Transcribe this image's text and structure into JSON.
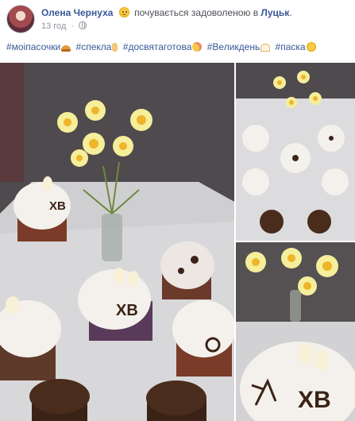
{
  "post": {
    "author": "Олена Чернуха",
    "feeling": "почувається задоволеною в",
    "location": "Луцьк",
    "location_suffix": ".",
    "timestamp": "13 год",
    "separator": "·",
    "privacy_icon": "globe-icon",
    "feeling_icon": "smiling-face-icon"
  },
  "hashtags": [
    {
      "text": "#моіпасочки",
      "emoji": "bread-icon"
    },
    {
      "text": "#спекла",
      "emoji": "victory-hand-icon"
    },
    {
      "text": "#досвятаготова",
      "emoji": "blushing-face-icon"
    },
    {
      "text": "#Великдень",
      "emoji": "birthday-cake-icon"
    },
    {
      "text": "#паска",
      "emoji": "smiling-face-icon"
    }
  ],
  "photos": {
    "count": 3,
    "cake_lettering": "ХВ",
    "colors": {
      "tablecloth": "#d8d8da",
      "wall": "#4f4a4e",
      "icing": "#f4f1ec",
      "chocolate": "#3a2316",
      "daffodil": "#f5ee9a",
      "daffodil_center": "#f0b429"
    }
  }
}
